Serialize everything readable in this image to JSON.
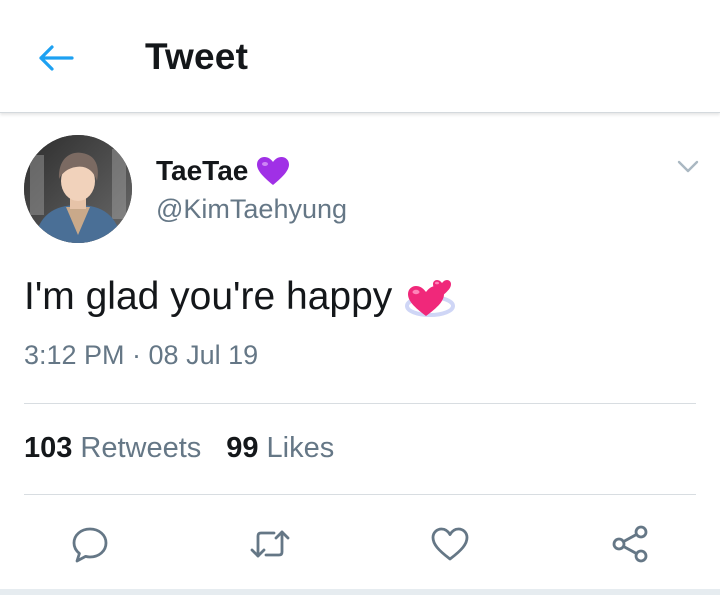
{
  "header": {
    "title": "Tweet",
    "back_icon": "arrow-left-icon",
    "accent_color": "#1da1f2"
  },
  "tweet": {
    "display_name": "TaeTae",
    "name_emoji": "purple-heart-emoji",
    "username": "@KimTaehyung",
    "text": "I'm glad you're happy",
    "text_emoji": "two-hearts-emoji",
    "timestamp": "3:12 PM · 08 Jul 19",
    "menu_icon": "chevron-down-icon"
  },
  "stats": {
    "retweets_count": "103",
    "retweets_label": "Retweets",
    "likes_count": "99",
    "likes_label": "Likes"
  },
  "actions": [
    {
      "icon": "reply-icon"
    },
    {
      "icon": "retweet-icon"
    },
    {
      "icon": "heart-icon"
    },
    {
      "icon": "share-icon"
    }
  ],
  "colors": {
    "text_primary": "#14171a",
    "text_secondary": "#657786",
    "divider": "#d8dde1",
    "icon_gray": "#657786",
    "emoji_purple": "#a030e6",
    "emoji_pink": "#f0287a"
  }
}
